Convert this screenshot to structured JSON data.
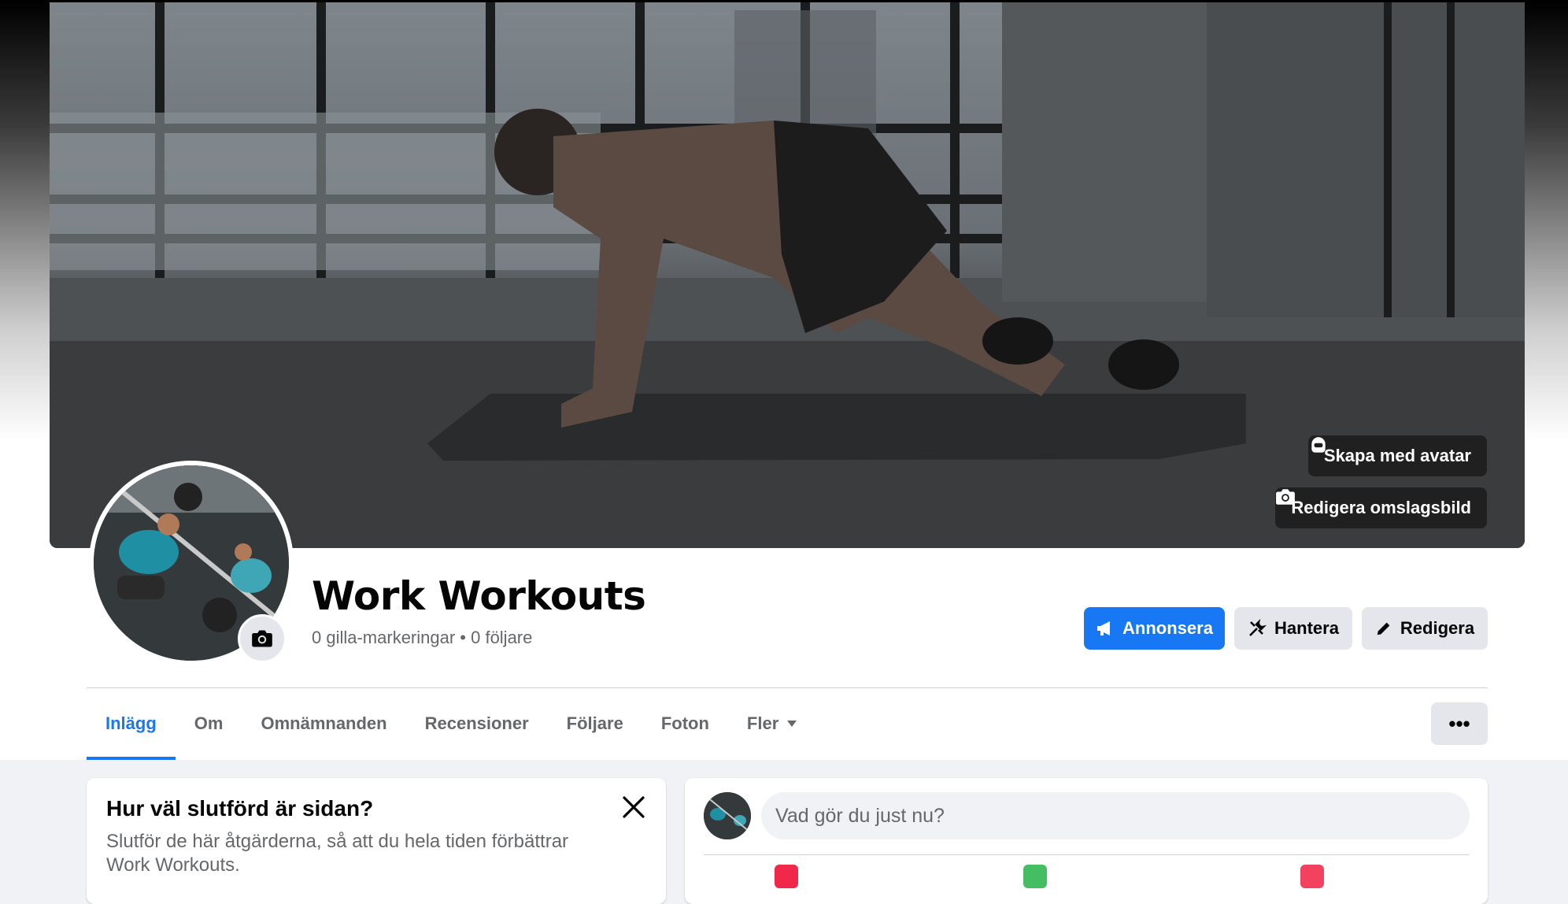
{
  "cover": {
    "avatar_button": "Skapa med avatar",
    "edit_cover_button": "Redigera omslagsbild"
  },
  "page": {
    "name": "Work Workouts",
    "stats": "0 gilla-markeringar • 0 följare"
  },
  "actions": {
    "advertise": "Annonsera",
    "manage": "Hantera",
    "edit": "Redigera"
  },
  "tabs": [
    {
      "label": "Inlägg",
      "active": true
    },
    {
      "label": "Om"
    },
    {
      "label": "Omnämnanden"
    },
    {
      "label": "Recensioner"
    },
    {
      "label": "Följare"
    },
    {
      "label": "Foton"
    },
    {
      "label": "Fler"
    }
  ],
  "more_button": "•••",
  "completion": {
    "title": "Hur väl slutförd är sidan?",
    "text": "Slutför de här åtgärderna, så att du hela tiden förbättrar",
    "page_name": "Work Workouts",
    "suffix": "."
  },
  "composer": {
    "placeholder": "Vad gör du just nu?"
  },
  "colors": {
    "accent": "#1877f2",
    "grey_button": "#e4e6eb",
    "background": "#f0f2f5"
  }
}
